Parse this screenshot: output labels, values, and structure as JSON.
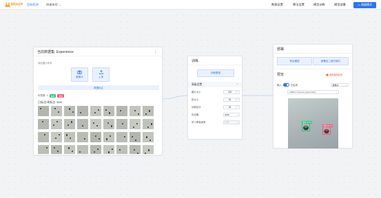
{
  "header": {
    "logo_text_a": "Mind",
    "logo_text_b": "+",
    "current_nav": "目标检测",
    "experience_menu": "快速体验",
    "menus": [
      "数据设置",
      "教法设置",
      "模型训练",
      "模型部署"
    ],
    "advanced_button": "高级模式"
  },
  "dataset": {
    "title": "当前数据集: Experience",
    "add_hint": "添加图片样本:",
    "btn_capture": "摄像头",
    "btn_upload": "上传",
    "annotate_bar": "数据标注",
    "class_label": "标签数: 2",
    "tags": [
      {
        "text": "酱料",
        "color": "#2fc27a"
      },
      {
        "text": "调料",
        "color": "#f0587a"
      }
    ],
    "count_text": "已标注/未标注: 80/0",
    "thumbnail_count": 36
  },
  "train": {
    "title": "训练",
    "train_button": "训练模型",
    "advanced_title": "高级设置",
    "params": [
      {
        "label": "图片大小",
        "value": "224",
        "kind": "stepper"
      },
      {
        "label": "批大小",
        "value": "16",
        "kind": "stepper"
      },
      {
        "label": "训练轮次",
        "value": "30",
        "kind": "stepper"
      },
      {
        "label": "优化器",
        "value": "auto",
        "kind": "select"
      },
      {
        "label": "学习率衰减率",
        "value": "0.01",
        "kind": "select-disabled"
      }
    ]
  },
  "deploy": {
    "title": "部署",
    "btn_export": "导出模型",
    "btn_deploy": "部署至二维开源口",
    "preview_title": "预览",
    "feedback": "我的使用反馈",
    "input_label": "输入",
    "camera_on": "已启用",
    "mode_select": "摄像头",
    "camera_device": "USB2.0 Camera (1e4e:0110)",
    "detections": [
      {
        "label": "酱料 85.3%",
        "color": "#2fc27a"
      },
      {
        "label": "调料 86.4%",
        "color": "#f0587a"
      }
    ]
  },
  "colors": {
    "accent": "#2f73f0",
    "logo": "#f7a52b"
  }
}
